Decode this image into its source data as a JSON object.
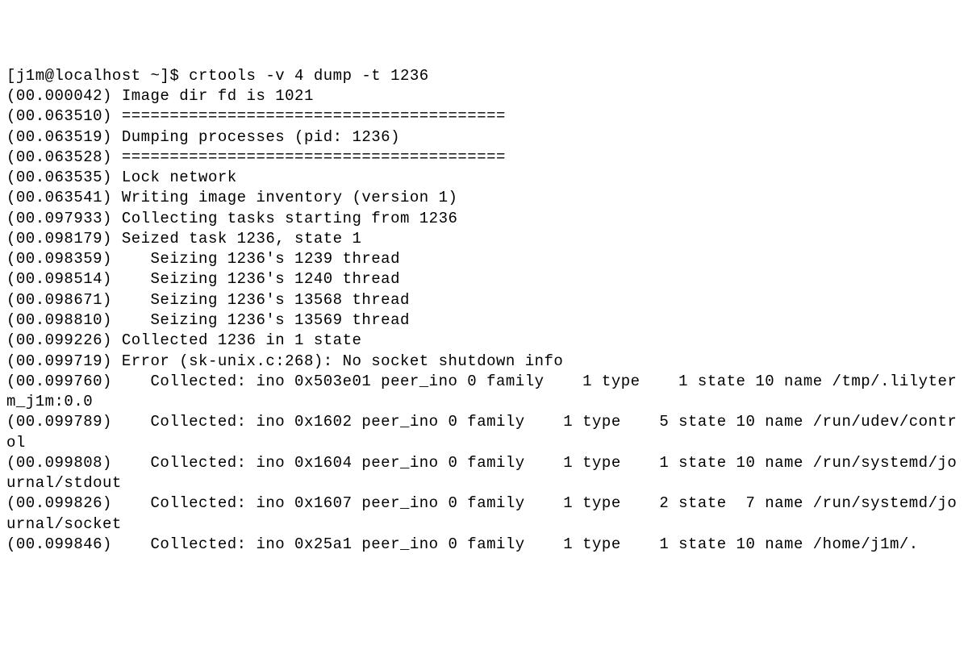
{
  "prompt": {
    "user_host_cwd": "[j1m@localhost ~]$",
    "command": "crtools -v 4 dump -t 1236"
  },
  "lines": [
    "(00.000042) Image dir fd is 1021",
    "(00.063510) ========================================",
    "(00.063519) Dumping processes (pid: 1236)",
    "(00.063528) ========================================",
    "(00.063535) Lock network",
    "(00.063541) Writing image inventory (version 1)",
    "(00.097933) Collecting tasks starting from 1236",
    "(00.098179) Seized task 1236, state 1",
    "(00.098359)    Seizing 1236's 1239 thread",
    "(00.098514)    Seizing 1236's 1240 thread",
    "(00.098671)    Seizing 1236's 13568 thread",
    "(00.098810)    Seizing 1236's 13569 thread",
    "(00.099226) Collected 1236 in 1 state",
    "(00.099719) Error (sk-unix.c:268): No socket shutdown info",
    "(00.099760)    Collected: ino 0x503e01 peer_ino 0 family    1 type    1 state 10 name /tmp/.lilyterm_j1m:0.0",
    "(00.099789)    Collected: ino 0x1602 peer_ino 0 family    1 type    5 state 10 name /run/udev/control",
    "(00.099808)    Collected: ino 0x1604 peer_ino 0 family    1 type    1 state 10 name /run/systemd/journal/stdout",
    "(00.099826)    Collected: ino 0x1607 peer_ino 0 family    1 type    2 state  7 name /run/systemd/journal/socket",
    "(00.099846)    Collected: ino 0x25a1 peer_ino 0 family    1 type    1 state 10 name /home/j1m/."
  ]
}
